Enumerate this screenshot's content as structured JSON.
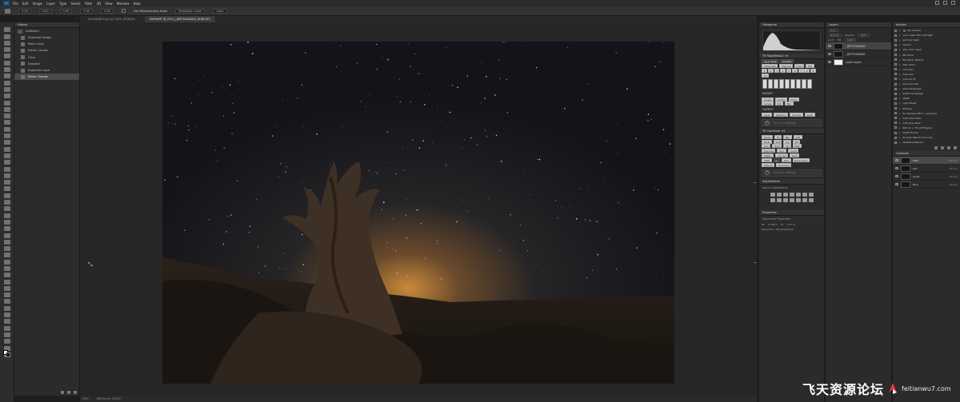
{
  "menubar": {
    "items": [
      "File",
      "Edit",
      "Image",
      "Layer",
      "Type",
      "Select",
      "Filter",
      "3D",
      "View",
      "Window",
      "Help"
    ]
  },
  "options": {
    "fields": [
      "0.00",
      "0.00",
      "0.00",
      "0.00",
      "0.00"
    ],
    "measure_label": "Use Measurement Scale",
    "straighten": "Straighten Layer",
    "clear": "Clear"
  },
  "tabs": [
    {
      "label": "mediaDBL3.jpg @ 100% (RGB/8*)",
      "active": false
    },
    {
      "label": "SkiffleMT @ 25% (_DBT3SAUNDS_RGB/16*)",
      "active": true
    }
  ],
  "history": {
    "title": "History",
    "snapshot": "Untitled-1",
    "items": [
      {
        "label": "Duplicate Image",
        "selected": false
      },
      {
        "label": "Make Layer",
        "selected": false
      },
      {
        "label": "Select Canvas",
        "selected": false
      },
      {
        "label": "Clear",
        "selected": false
      },
      {
        "label": "Deselect",
        "selected": false
      },
      {
        "label": "Duplicate Layer",
        "selected": false
      },
      {
        "label": "Name Change",
        "selected": true
      }
    ]
  },
  "status": {
    "zoom": "25%",
    "doc": "Efficiency: 100%*"
  },
  "histogram": {
    "title": "Histogram"
  },
  "rapidmask": {
    "title": "TK RapidMask2 V4",
    "row1": [
      "Layer Mask",
      "SOURCE"
    ],
    "row2": [
      "Composite",
      "Channel",
      "Color",
      "SAT"
    ],
    "numbers": [
      "1",
      "2",
      "3",
      "4",
      "5",
      "6",
      "7",
      "8",
      "9",
      "10"
    ],
    "modify": "MODIFY",
    "row3": [
      "Loader",
      "Combo",
      "Finish"
    ],
    "row4": [
      "Curves",
      "Dot",
      "Blur"
    ],
    "output": "OUTPUT",
    "row5": [
      "Layer",
      "Selection",
      "Channel",
      "Apply"
    ],
    "click_label": "Click for settings"
  },
  "combiner": {
    "title": "TK Combiner V4",
    "rowA": [
      "Stroke",
      "Fill"
    ],
    "rowB": [
      "Blur",
      "ACR"
    ],
    "rowC": [
      "Burst",
      "Soft",
      "Col",
      "Stz"
    ],
    "rowD": [
      "Lum",
      "Hard",
      "Ovl",
      "Mult"
    ],
    "rowE": [
      "Dup Img",
      "Sync",
      "S & M"
    ],
    "rowF": [
      "Flatten",
      "Convert",
      "Save"
    ],
    "extra": [
      "Auto",
      "Extra Sharp",
      "Vertical",
      "Horizontal"
    ],
    "size_value": "1000",
    "size_unit": "px",
    "click_label": "Click for settings"
  },
  "adjustments": {
    "title": "Adjustments",
    "subtitle": "Add an adjustment"
  },
  "properties": {
    "title": "Properties",
    "subtitle": "Document Properties",
    "w_label": "W:",
    "w_value": "12.00 in",
    "h_label": "H:",
    "h_value": "7.97 in",
    "res": "Resolution: 300 pixels/inch"
  },
  "layers": {
    "title": "Layers",
    "kind": "Kind",
    "blend": "Normal",
    "opacity_label": "Opacity:",
    "opacity": "100%",
    "lock_label": "Lock:",
    "fill_label": "Fill:",
    "fill": "100%",
    "items": [
      {
        "label": "_DBT3SAUNDS",
        "thumb": "dark",
        "selected": true
      },
      {
        "label": "_DBT3SAUNDS",
        "thumb": "dark",
        "selected": false
      },
      {
        "label": "Load Layers",
        "thumb": "white",
        "selected": false
      }
    ]
  },
  "actions": {
    "title": "Actions",
    "items": [
      "My Actions",
      "Lum mask 30% soft light",
      "portrait mask",
      "Orton1",
      "star color mask",
      "BG Orton",
      "BG Orton Texture",
      "Star Orton",
      "sndonaro",
      "T-fps blur",
      "portrait TS",
      "pixel portrait",
      "pixel landscape",
      "SQSP Homepage",
      "sRGB",
      "Light Bleed",
      "BE glow",
      "SL Sharpen 90% + soft glow",
      "Soft Glow 2010",
      "soft glow 2012",
      "900 px + TK soft Engine",
      "SQSP Thumb",
      "SI Insta Safe 4:5 Run efc...",
      "Default preferenc"
    ]
  },
  "channels": {
    "title": "Channels",
    "items": [
      {
        "label": "RGB",
        "short": "Ctrl+2"
      },
      {
        "label": "Red",
        "short": "Ctrl+3"
      },
      {
        "label": "Green",
        "short": "Ctrl+4"
      },
      {
        "label": "Blue",
        "short": "Ctrl+5"
      }
    ]
  },
  "watermark": {
    "cn": "飞天资源论坛",
    "url": "feitianwu7.com"
  }
}
